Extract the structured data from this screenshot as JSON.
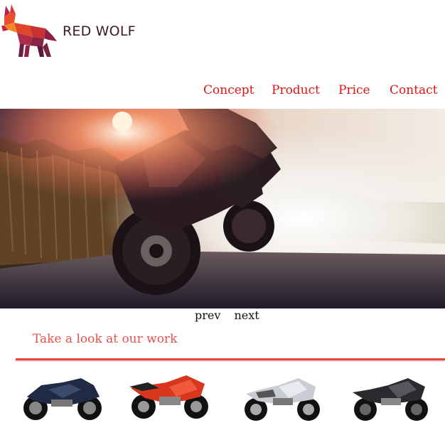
{
  "header": {
    "brand_name": "RED WOLF",
    "logo_icon": "red-wolf-icon"
  },
  "nav": {
    "items": [
      "Concept",
      "Product",
      "Price",
      "Contact"
    ]
  },
  "slider": {
    "prev_label": "prev",
    "next_label": "next"
  },
  "gallery": {
    "title": "Take a look at our work",
    "items": [
      {
        "icon": "motorcycle-navy-icon",
        "color": "#1f2a44"
      },
      {
        "icon": "motorcycle-red-icon",
        "color": "#d8361e"
      },
      {
        "icon": "motorcycle-silver-icon",
        "color": "#c9ccd2"
      },
      {
        "icon": "motorcycle-black-icon",
        "color": "#2a2b2e"
      }
    ]
  },
  "colors": {
    "accent": "#e01414",
    "title": "#e8514a",
    "divider": "#e8463c",
    "brand_text": "#3b1a26"
  }
}
